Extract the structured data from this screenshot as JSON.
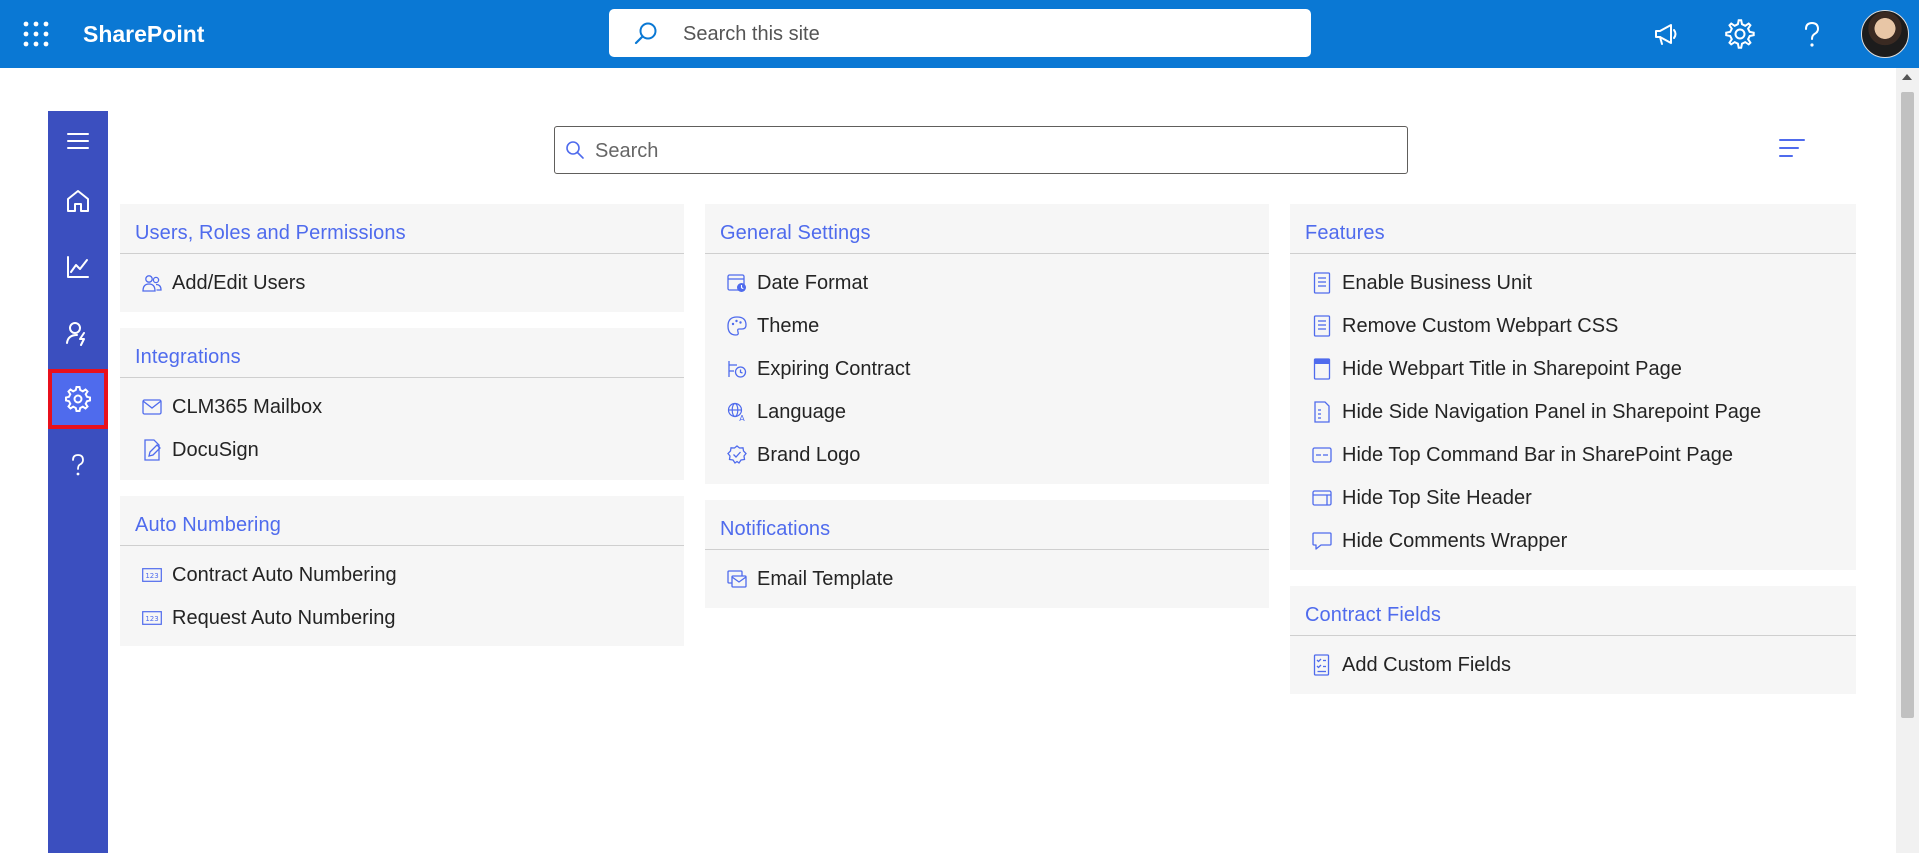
{
  "suitebar": {
    "brand": "SharePoint",
    "search_placeholder": "Search this site"
  },
  "main": {
    "search_placeholder": "Search"
  },
  "columns": [
    {
      "cards": [
        {
          "title": "Users, Roles and Permissions",
          "items": [
            {
              "label": "Add/Edit Users",
              "icon": "users-icon"
            }
          ]
        },
        {
          "title": "Integrations",
          "items": [
            {
              "label": "CLM365 Mailbox",
              "icon": "mail-icon"
            },
            {
              "label": "DocuSign",
              "icon": "document-edit-icon"
            }
          ]
        },
        {
          "title": "Auto Numbering",
          "items": [
            {
              "label": "Contract Auto Numbering",
              "icon": "number-symbol-icon"
            },
            {
              "label": "Request Auto Numbering",
              "icon": "number-symbol-icon"
            }
          ]
        }
      ]
    },
    {
      "cards": [
        {
          "title": "General Settings",
          "items": [
            {
              "label": "Date Format",
              "icon": "calendar-clock-icon"
            },
            {
              "label": "Theme",
              "icon": "palette-icon"
            },
            {
              "label": "Expiring Contract",
              "icon": "timeline-clock-icon"
            },
            {
              "label": "Language",
              "icon": "globe-language-icon"
            },
            {
              "label": "Brand Logo",
              "icon": "badge-check-icon"
            }
          ]
        },
        {
          "title": "Notifications",
          "items": [
            {
              "label": "Email Template",
              "icon": "mail-template-icon"
            }
          ]
        }
      ]
    },
    {
      "cards": [
        {
          "title": "Features",
          "items": [
            {
              "label": "Enable Business Unit",
              "icon": "page-icon"
            },
            {
              "label": "Remove Custom Webpart CSS",
              "icon": "page-icon"
            },
            {
              "label": "Hide Webpart Title in Sharepoint Page",
              "icon": "page-header-icon"
            },
            {
              "label": "Hide Side Navigation Panel in Sharepoint Page",
              "icon": "page-nav-icon"
            },
            {
              "label": "Hide Top Command Bar in SharePoint Page",
              "icon": "command-bar-icon"
            },
            {
              "label": "Hide Top Site Header",
              "icon": "window-header-icon"
            },
            {
              "label": "Hide Comments Wrapper",
              "icon": "comment-icon"
            }
          ]
        },
        {
          "title": "Contract Fields",
          "items": [
            {
              "label": "Add Custom Fields",
              "icon": "form-checklist-icon"
            }
          ]
        }
      ]
    }
  ],
  "colors": {
    "suitebar": "#0a78d4",
    "rail": "#3b4fbf",
    "accent": "#4f6bed",
    "highlight": "#e8101c"
  }
}
